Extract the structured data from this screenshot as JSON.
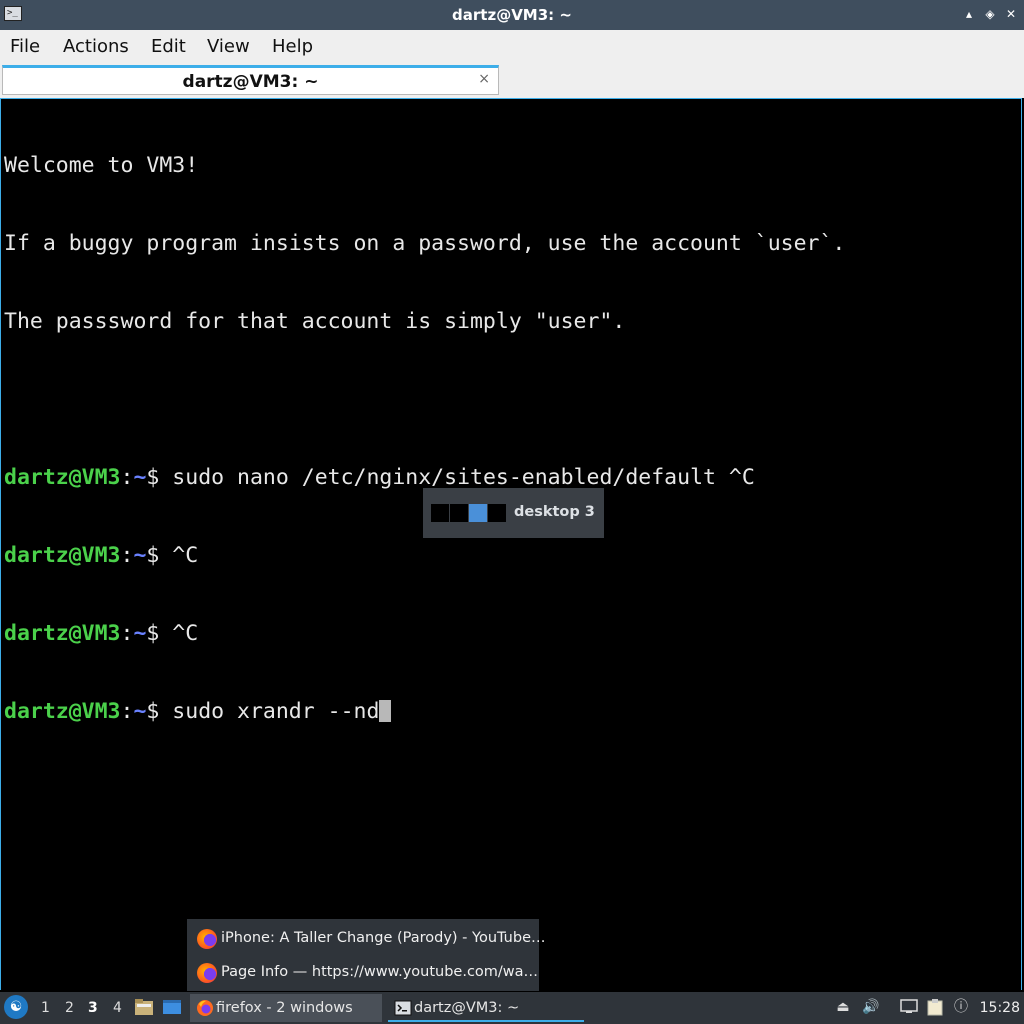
{
  "window": {
    "title": "dartz@VM3: ~",
    "app_icon_text": ">_",
    "controls": {
      "minimize": "▴",
      "maximize": "◈",
      "close": "✕"
    }
  },
  "menu": [
    {
      "label": "File"
    },
    {
      "label": "Actions"
    },
    {
      "label": "Edit"
    },
    {
      "label": "View"
    },
    {
      "label": "Help"
    }
  ],
  "tab": {
    "label": "dartz@VM3: ~",
    "close": "×"
  },
  "terminal": {
    "welcome": [
      "Welcome to VM3!",
      "If a buggy program insists on a password, use the account `user`.",
      "The passsword for that account is simply \"user\"."
    ],
    "prompt": {
      "user": "dartz@VM3",
      "colon": ":",
      "path": "~",
      "dollar": "$"
    },
    "commands": [
      " sudo nano /etc/nginx/sites-enabled/default ^C",
      " ^C",
      " ^C",
      " sudo xrandr --nd"
    ]
  },
  "osd": {
    "label": "desktop 3",
    "active_desktop": 3,
    "desktop_count": 4
  },
  "popup": {
    "items": [
      {
        "label": "iPhone: A Taller Change (Parody) - YouTube…"
      },
      {
        "label": "Page Info — https://www.youtube.com/wa…"
      }
    ]
  },
  "panel": {
    "start_icon": "☯",
    "workspaces": [
      "1",
      "2",
      "3",
      "4"
    ],
    "current_workspace": "3",
    "tasks": [
      {
        "label": "firefox - 2 windows"
      },
      {
        "label": "dartz@VM3: ~"
      }
    ],
    "clock": "15:28",
    "tray": {
      "volume": "🔊",
      "info": "ⓘ",
      "eject": "⏏"
    }
  },
  "colors": {
    "accent": "#3daee9",
    "prompt_user": "#4bd14b",
    "prompt_path": "#6a82ff",
    "osd_active": "#4a90d9"
  }
}
